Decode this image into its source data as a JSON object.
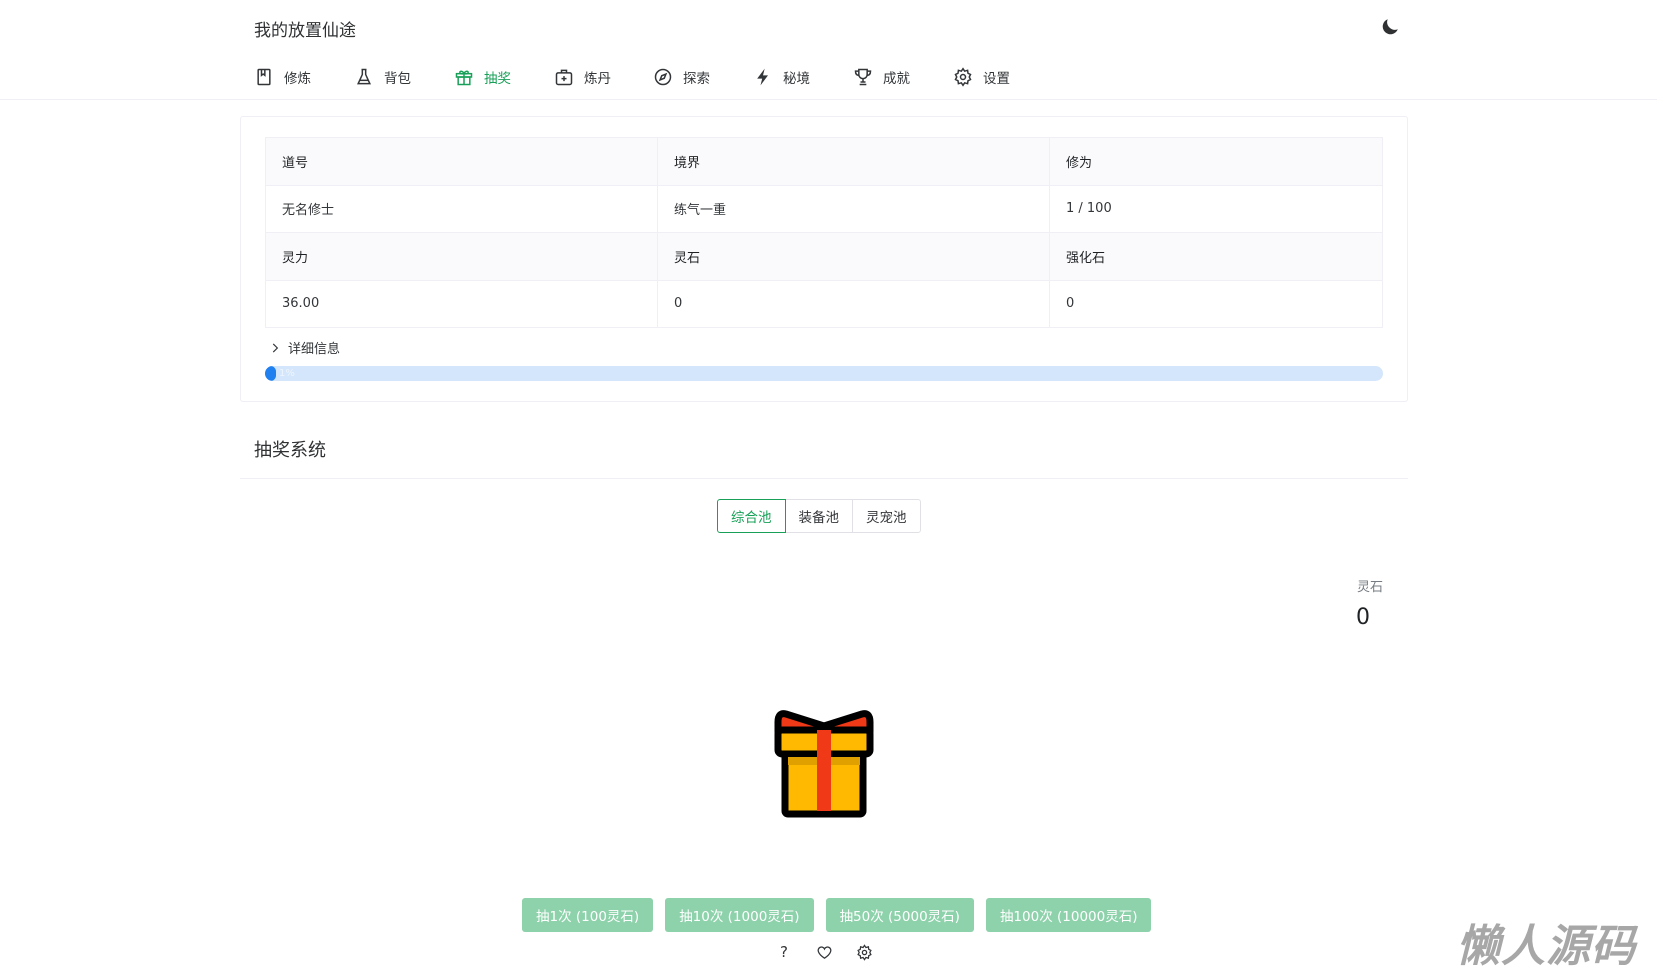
{
  "app": {
    "title": "我的放置仙途"
  },
  "nav": {
    "items": [
      {
        "label": "修炼",
        "icon": "book-icon"
      },
      {
        "label": "背包",
        "icon": "flask-icon"
      },
      {
        "label": "抽奖",
        "icon": "gift-icon",
        "active": true
      },
      {
        "label": "炼丹",
        "icon": "medkit-icon"
      },
      {
        "label": "探索",
        "icon": "compass-icon"
      },
      {
        "label": "秘境",
        "icon": "flash-icon"
      },
      {
        "label": "成就",
        "icon": "trophy-icon"
      },
      {
        "label": "设置",
        "icon": "gear-icon"
      }
    ]
  },
  "theme": {
    "icon": "moon-icon"
  },
  "stats": {
    "headers1": [
      "道号",
      "境界",
      "修为"
    ],
    "values1": [
      "无名修士",
      "练气一重",
      "1 / 100"
    ],
    "headers2": [
      "灵力",
      "灵石",
      "强化石"
    ],
    "values2": [
      "36.00",
      "0",
      "0"
    ],
    "details_label": "详细信息",
    "progress_percent": 1,
    "progress_text": "1%"
  },
  "gacha": {
    "section_title": "抽奖系统",
    "pools": [
      "综合池",
      "装备池",
      "灵宠池"
    ],
    "active_pool": 0,
    "stone_label": "灵石",
    "stone_value": "0",
    "buttons": [
      "抽1次 (100灵石)",
      "抽10次 (1000灵石)",
      "抽50次 (5000灵石)",
      "抽100次 (10000灵石)"
    ],
    "help_symbol": "?",
    "bottom_icons": [
      "help-icon",
      "heart-icon",
      "gear-icon"
    ]
  },
  "watermark": {
    "text": "懒人源码"
  },
  "colors": {
    "accent": "#18a058",
    "accent_disabled": "#8ed2ab",
    "progress": "#2080f0",
    "progress_track": "#d4e6fb",
    "gift_box": "#ffb900",
    "gift_ribbon": "#f03a17"
  }
}
